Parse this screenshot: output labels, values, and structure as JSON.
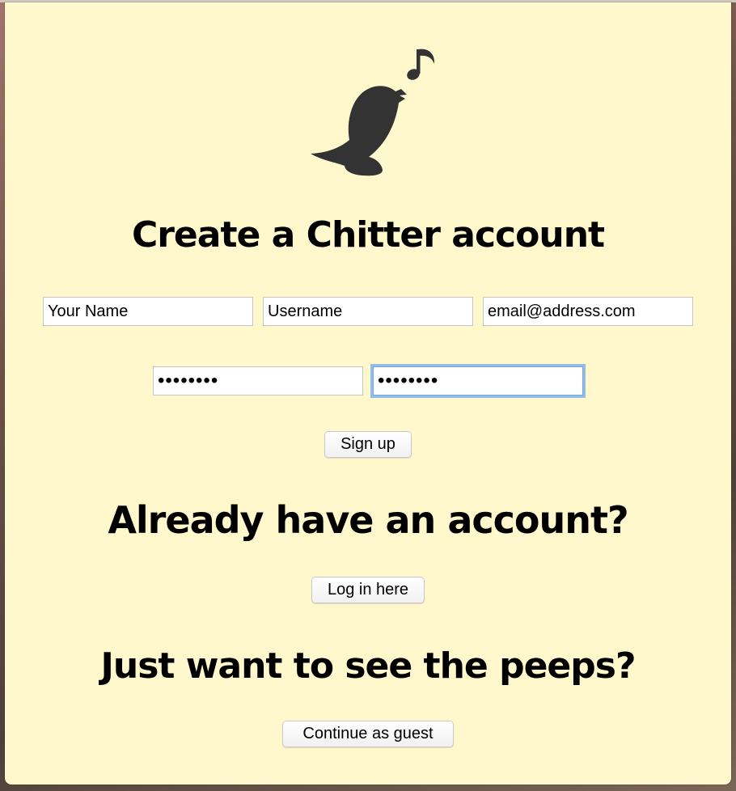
{
  "signup": {
    "title": "Create a Chitter account",
    "name_placeholder": "Your Name",
    "username_placeholder": "Username",
    "email_placeholder": "email@address.com",
    "password_value": "••••••••",
    "password_confirm_value": "••••••••",
    "submit_label": "Sign up"
  },
  "login": {
    "title": "Already have an account?",
    "button_label": "Log in here"
  },
  "guest": {
    "title": "Just want to see the peeps?",
    "button_label": "Continue as guest"
  },
  "colors": {
    "page_background": "#fff8cc",
    "logo": "#333333",
    "focus_ring": "#6eaaf0"
  },
  "icons": {
    "logo": "bird-singing-icon"
  }
}
